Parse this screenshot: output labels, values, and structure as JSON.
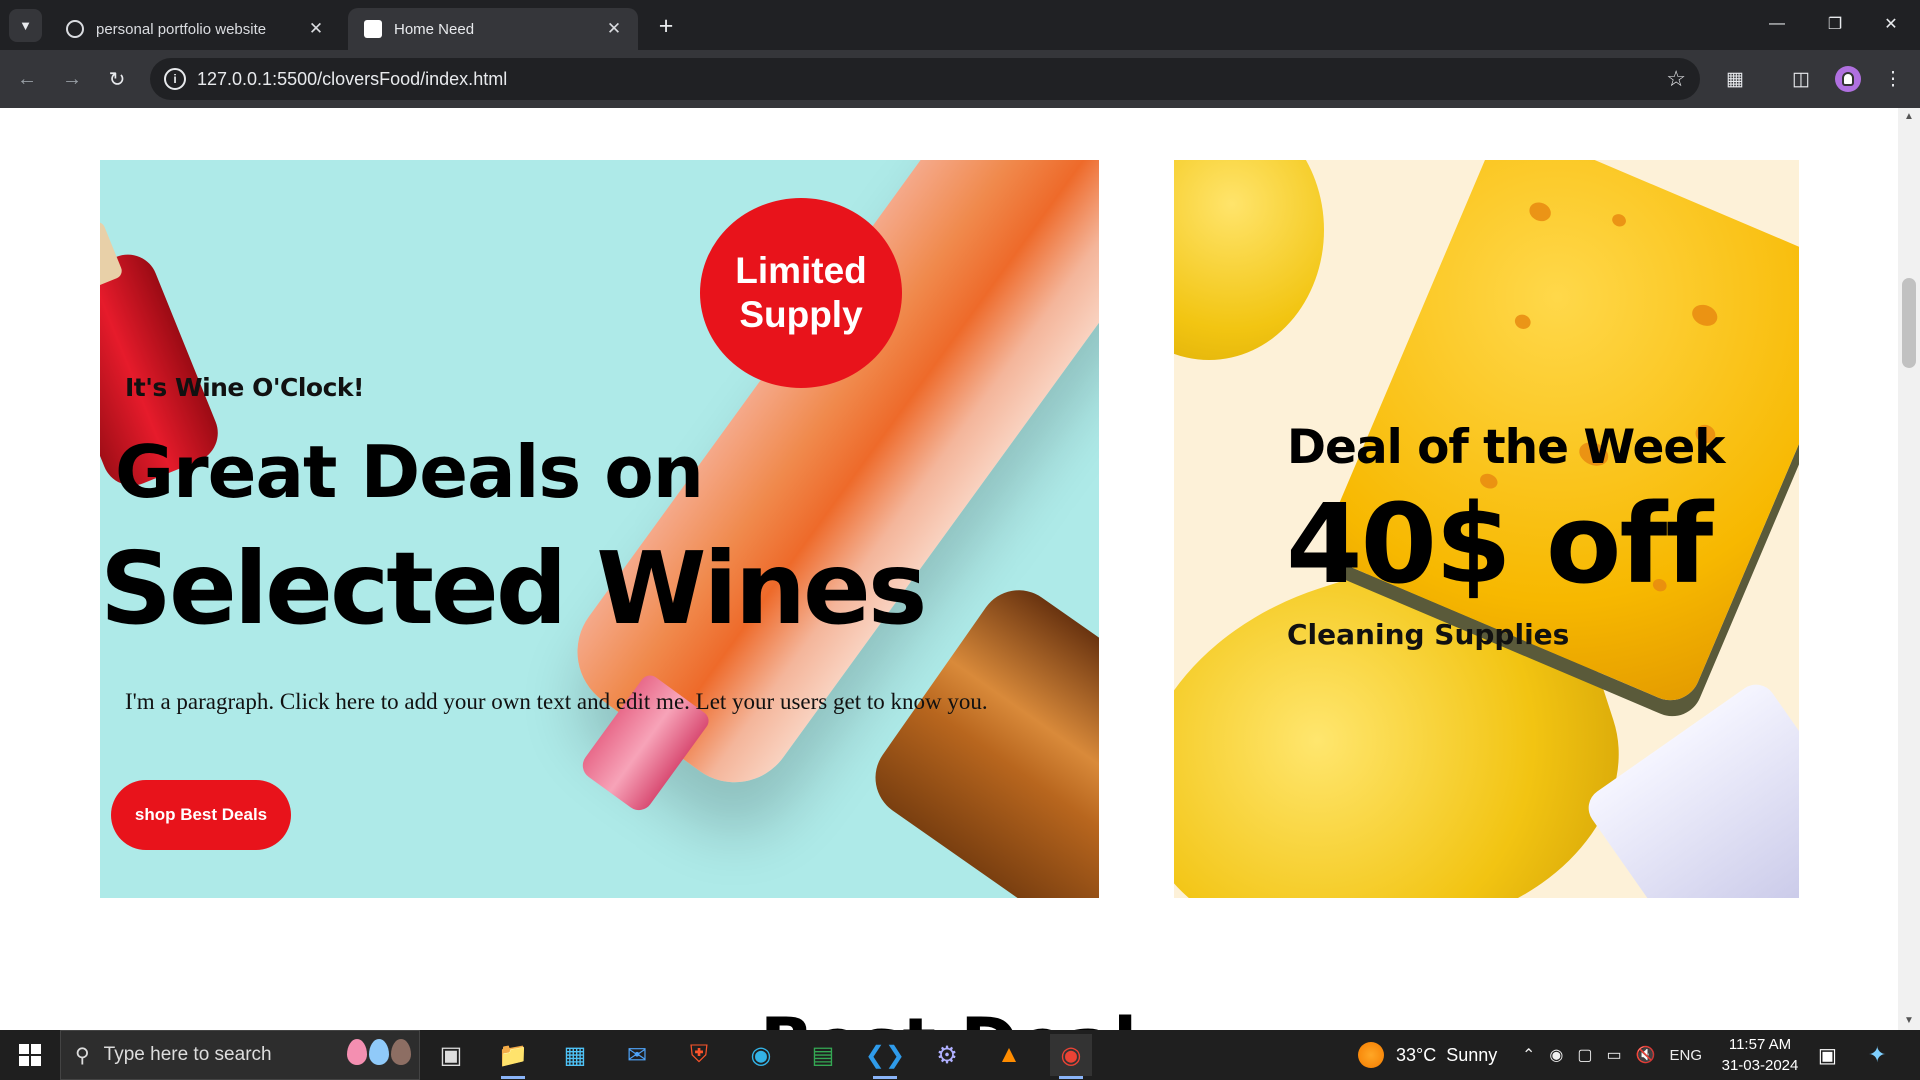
{
  "browser": {
    "tabs": [
      {
        "title": "personal portfolio website",
        "active": false
      },
      {
        "title": "Home Need",
        "active": true
      }
    ],
    "url": "127.0.0.1:5500/cloversFood/index.html"
  },
  "promo_wine": {
    "badge": "Limited Supply",
    "kicker": "It's Wine O'Clock!",
    "headline_line1": "Great Deals on",
    "headline_line2": "Selected Wines",
    "paragraph": "I'm a paragraph. Click here to add your own text and edit me. Let your users get to know you.",
    "cta": "shop Best Deals"
  },
  "promo_sponge": {
    "title": "Deal of the Week",
    "amount": "40$ off",
    "subtitle": "Cleaning Supplies"
  },
  "next_section": {
    "heading_partial": "Best Deal"
  },
  "taskbar": {
    "search_placeholder": "Type here to search",
    "weather": "33°C  Sunny",
    "language": "ENG",
    "time": "11:57 AM",
    "date": "31-03-2024"
  },
  "colors": {
    "accent_red": "#e8131b",
    "wine_bg": "#aeeae8",
    "sponge_bg": "#fdf1d8"
  }
}
